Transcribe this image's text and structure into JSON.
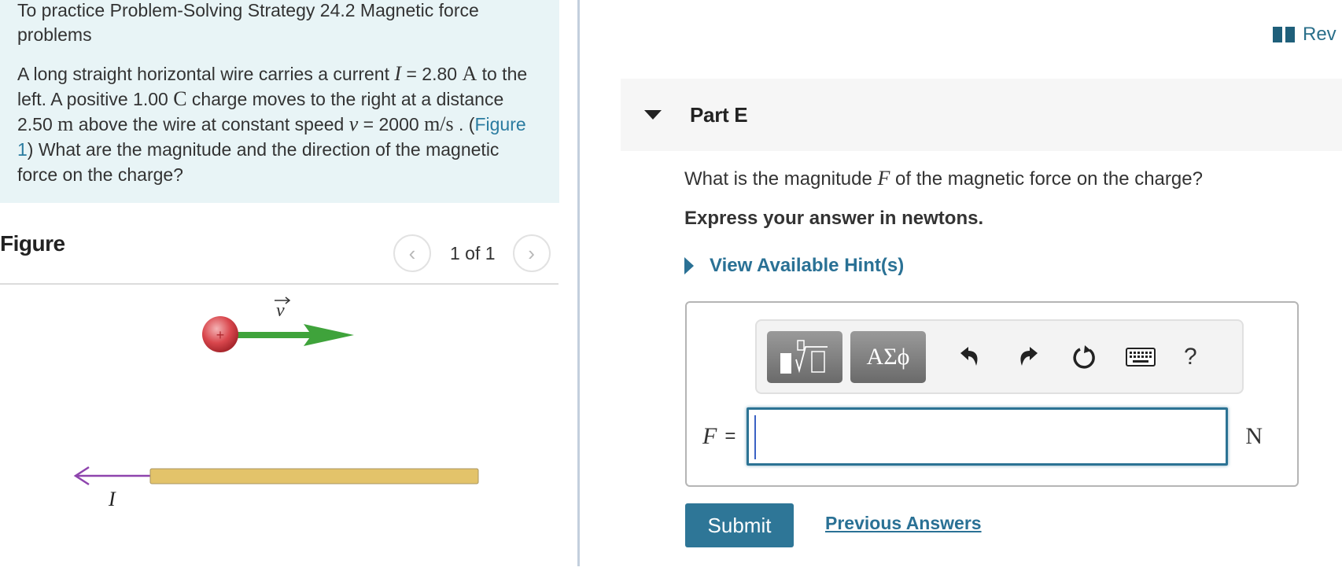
{
  "intro": {
    "title": "To practice Problem-Solving Strategy 24.2 Magnetic force problems",
    "text_1": "A long straight horizontal wire carries a current ",
    "var_I": "I",
    "text_2": " = 2.80 ",
    "unit_A": "A",
    "text_3": " to the left. A positive 1.00 ",
    "unit_C": "C",
    "text_4": " charge moves to the right at a distance 2.50 ",
    "unit_m": "m",
    "text_5": " above the wire at constant speed ",
    "var_v": "v",
    "text_6": " = 2000 ",
    "unit_ms": "m/s",
    "text_7": " . (",
    "figure_link": "Figure 1",
    "text_8": ") What are the magnitude and the direction of the magnetic force on the charge?"
  },
  "figure": {
    "title": "Figure",
    "pager_text": "1 of 1",
    "prev_icon": "chevron-left-icon",
    "next_icon": "chevron-right-icon",
    "velocity_label": "v",
    "current_label": "I",
    "charge_sign": "+",
    "colors": {
      "charge": "#d9474d",
      "velocity_arrow": "#3fa33b",
      "wire": "#e3c36a",
      "current_arrow": "#8e44ad"
    }
  },
  "review": {
    "label": "Rev",
    "icon": "book-icon"
  },
  "part": {
    "title": "Part E",
    "question_1": "What is the magnitude ",
    "question_var": "F",
    "question_2": " of the magnetic force on the charge?",
    "instruction": "Express your answer in newtons.",
    "hint_link": "View Available Hint(s)"
  },
  "toolbar": {
    "templates_icon": "templates-icon",
    "greek_label": "ΑΣϕ",
    "undo_icon": "undo-icon",
    "redo_icon": "redo-icon",
    "reset_icon": "reset-icon",
    "keyboard_icon": "keyboard-icon",
    "help_label": "?"
  },
  "answer": {
    "variable": "F",
    "equals": "=",
    "value": "",
    "unit": "N"
  },
  "actions": {
    "submit": "Submit",
    "previous_answers": "Previous Answers"
  },
  "colors": {
    "accent": "#2e7697",
    "intro_bg": "#e8f4f6",
    "part_header_bg": "#f6f6f6"
  }
}
